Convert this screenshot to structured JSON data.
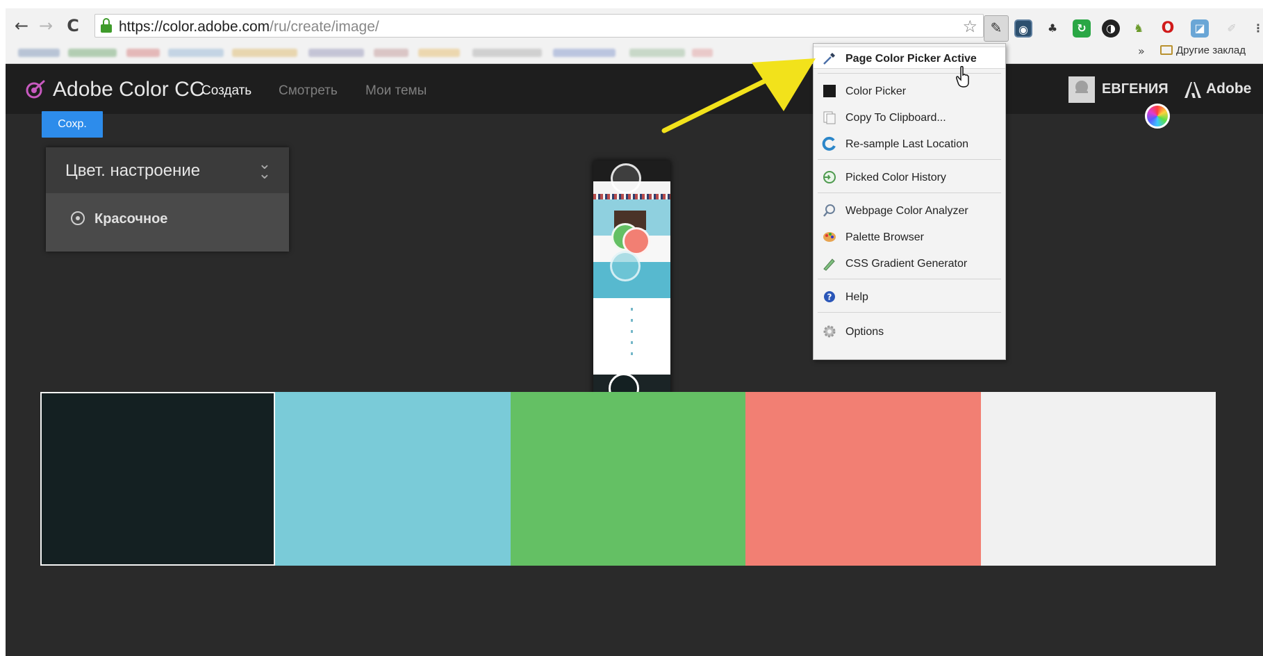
{
  "browser": {
    "url_host": "https://color.adobe.com",
    "url_path": "/ru/create/image/",
    "back_glyph": "←",
    "forward_glyph": "→",
    "reload_glyph": "C",
    "bookmark_more": "»",
    "other_bookmarks": "Другие заклад"
  },
  "app": {
    "brand": "Adobe Color CC",
    "menu": [
      {
        "label": "Создать",
        "active": true
      },
      {
        "label": "Смотреть",
        "active": false
      },
      {
        "label": "Мои темы",
        "active": false
      }
    ],
    "user_name": "ЕВГЕНИЯ",
    "adobe_label": "Adobe",
    "save_label": "Сохр.",
    "mood_title": "Цвет. настроение",
    "mood_option": "Красочное"
  },
  "palette": {
    "colors": [
      "#142022",
      "#7acbd8",
      "#64c064",
      "#f27f73",
      "#f1f1f1"
    ]
  },
  "extension_menu": {
    "items": [
      {
        "label": "Page Color Picker Active",
        "icon": "eyedropper-icon",
        "active": true
      },
      {
        "label": "Color Picker",
        "icon": "black-square-icon"
      },
      {
        "label": "Copy To Clipboard...",
        "icon": "clipboard-icon"
      },
      {
        "label": "Re-sample Last Location",
        "icon": "resample-icon"
      },
      {
        "label": "Picked Color History",
        "icon": "history-icon"
      },
      {
        "label": "Webpage Color Analyzer",
        "icon": "magnifier-icon"
      },
      {
        "label": "Palette Browser",
        "icon": "palette-icon"
      },
      {
        "label": "CSS Gradient Generator",
        "icon": "gradient-pen-icon"
      },
      {
        "label": "Help",
        "icon": "help-icon"
      },
      {
        "label": "Options",
        "icon": "gear-icon"
      }
    ]
  }
}
